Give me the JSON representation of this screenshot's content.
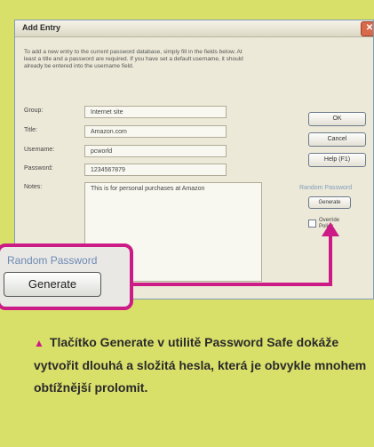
{
  "dialog": {
    "title": "Add Entry",
    "close_symbol": "✕",
    "intro": "To add a new entry to the current password database, simply fill in the fields below. At\nleast a title and a password are required. If you have set a default username, it should\nalready be entered into the username field.",
    "fields": {
      "group_label": "Group:",
      "group_value": "Internet site",
      "title_label": "Title:",
      "title_value": "Amazon.com",
      "username_label": "Username:",
      "username_value": "pcworld",
      "password_label": "Password:",
      "password_value": "1234567879",
      "notes_label": "Notes:",
      "notes_value": "This is for personal purchases at Amazon"
    },
    "buttons": {
      "ok": "OK",
      "cancel": "Cancel",
      "help": "Help (F1)"
    },
    "random_password_label": "Random Password",
    "generate_small": "Generate",
    "override_label": "Override Policy"
  },
  "callout": {
    "random_password_label": "Random Password",
    "generate_label": "Generate"
  },
  "caption": {
    "marker": "▲",
    "text": "Tlačítko Generate v utilitě Password Safe dokáže vytvořit dlouhá a složitá hesla, která je obvykle mnohem obtížnější prolomit."
  },
  "colors": {
    "background": "#d9e06a",
    "accent": "#cc1a86"
  }
}
